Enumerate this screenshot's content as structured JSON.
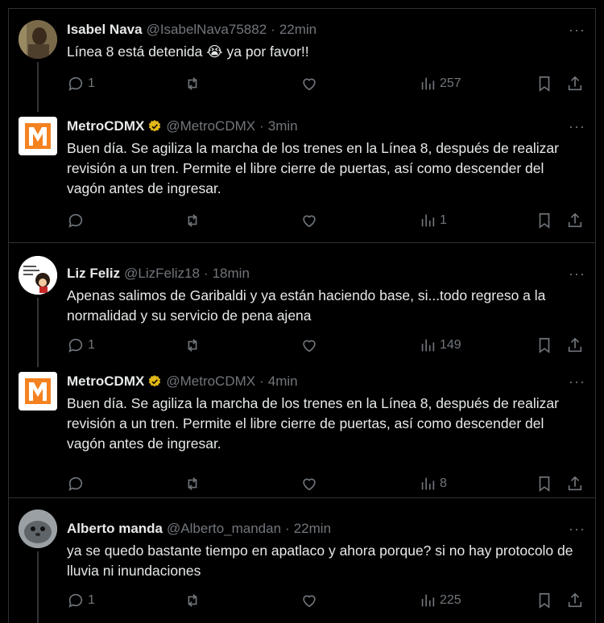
{
  "tweets": [
    {
      "name": "Isabel Nava",
      "handle": "@IsabelNava75882",
      "time": "22min",
      "verified": false,
      "text_before": "Línea 8 está detenida ",
      "emoji": "😭",
      "text_after": " ya por favor!!",
      "replies": "1",
      "views": "257",
      "avatar": "photo-avatar"
    },
    {
      "name": "MetroCDMX",
      "handle": "@MetroCDMX",
      "time": "3min",
      "verified": true,
      "text": "Buen día. Se agiliza la marcha de los trenes en la Línea 8, después de realizar revisión a un tren. Permite el libre cierre de puertas, así como descender del vagón antes de ingresar.",
      "replies": "",
      "views": "1",
      "avatar": "metro-logo"
    },
    {
      "name": "Liz Feliz",
      "handle": "@LizFeliz18",
      "time": "18min",
      "verified": false,
      "text": "Apenas salimos de Garibaldi y ya están haciendo base, si...todo regreso a la normalidad y su servicio de pena ajena",
      "replies": "1",
      "views": "149",
      "avatar": "cartoon-avatar"
    },
    {
      "name": "MetroCDMX",
      "handle": "@MetroCDMX",
      "time": "4min",
      "verified": true,
      "text": "Buen día. Se agiliza la marcha de los trenes en la Línea 8, después de realizar revisión a un tren. Permite el libre cierre de puertas, así como descender del vagón antes de ingresar.",
      "replies": "",
      "views": "8",
      "avatar": "metro-logo"
    },
    {
      "name": "Alberto manda",
      "handle": "@Alberto_mandan",
      "time": "22min",
      "verified": false,
      "text": "ya se quedo bastante tiempo en apatlaco y ahora porque? si no hay protocolo de lluvia ni inundaciones",
      "replies": "1",
      "views": "225",
      "avatar": "seal-avatar"
    }
  ],
  "ui": {
    "dot": "·",
    "more": "···"
  },
  "colors": {
    "background": "#000000",
    "text": "#e7e9ea",
    "muted": "#71767b",
    "verified": "#e2b719",
    "metro_orange": "#f58220"
  }
}
